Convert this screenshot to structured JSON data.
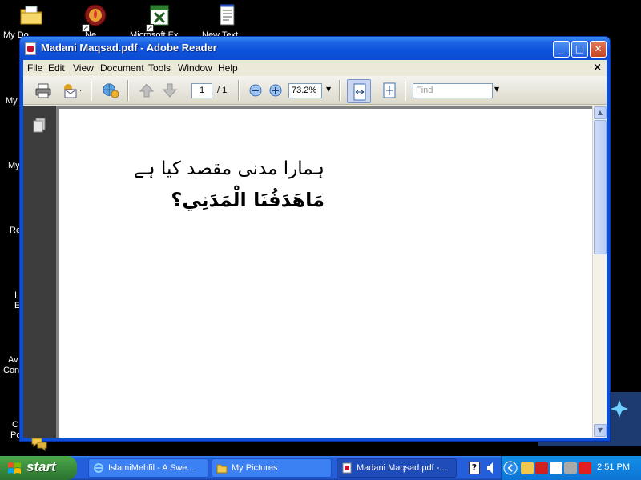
{
  "desktop": {
    "icons": [
      {
        "label": "My Do",
        "icon": "folder-documents-icon"
      },
      {
        "label": "Ne",
        "icon": "app-shortcut-icon"
      },
      {
        "label": "Microsoft Ex",
        "icon": "excel-icon"
      },
      {
        "label": "New Text",
        "icon": "notepad-icon"
      }
    ],
    "side_labels": [
      "My",
      "My",
      "Re",
      "I",
      "E",
      "Av",
      "Con",
      "C",
      "Po"
    ]
  },
  "window": {
    "title": "Madani Maqsad.pdf - Adobe Reader",
    "controls": {
      "minimize": "_",
      "maximize": "□",
      "close": "✕"
    }
  },
  "menu": {
    "items": [
      "File",
      "Edit",
      "View",
      "Document",
      "Tools",
      "Window",
      "Help"
    ],
    "close_doc": "×"
  },
  "toolbar": {
    "page_current": "1",
    "page_total": "/ 1",
    "zoom": "73.2%",
    "find_placeholder": "Find"
  },
  "document": {
    "line1": "ہمارا مدنی مقصد کیا ہے",
    "line2": "مَاهَدَفُنَا الْمَدَنِي؟"
  },
  "taskbar": {
    "start_label": "start",
    "tasks": [
      {
        "label": "IslamiMehfil - A Swe...",
        "icon": "ie-icon"
      },
      {
        "label": "My Pictures",
        "icon": "folder-icon"
      },
      {
        "label": "Madani Maqsad.pdf -...",
        "icon": "pdf-icon"
      }
    ],
    "clock": "2:51 PM"
  },
  "colors": {
    "window_blue": "#0a4fd6",
    "taskbar_blue": "#245edb",
    "start_green": "#38873a",
    "nav_pane": "#3c3c3c"
  }
}
